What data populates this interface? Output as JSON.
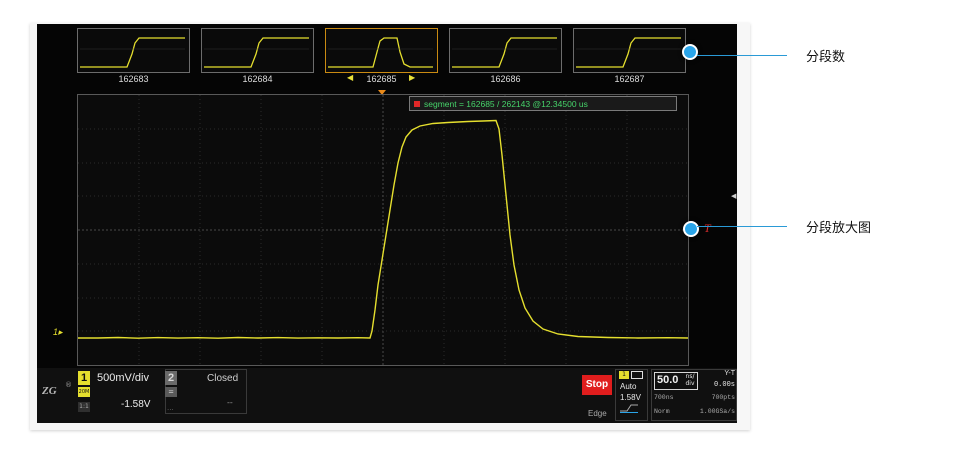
{
  "thumbnails": [
    {
      "label": "162683",
      "selected": false
    },
    {
      "label": "162684",
      "selected": false
    },
    {
      "label": "162685",
      "selected": true
    },
    {
      "label": "162686",
      "selected": false
    },
    {
      "label": "162687",
      "selected": false
    }
  ],
  "thumb_nav": {
    "prev": "◀",
    "next": "▶"
  },
  "segment_info": "segment = 162685 / 262143  @12.34500 us",
  "channel_marker": "1",
  "trigger_label": "T",
  "side_tab": "◀",
  "bottom_bar": {
    "logo": "ZG",
    "logo_reg": "®",
    "ch1": {
      "number": "1",
      "sub": "20M",
      "coupling": "1:1",
      "vdiv": "500mV/div",
      "offset": "-1.58V"
    },
    "ch2": {
      "number": "2",
      "sub": "=",
      "state": "Closed",
      "offset": "--",
      "dots": "..."
    },
    "stop": "Stop",
    "trigger": {
      "channel": "1",
      "mode": "Auto",
      "level": "1.58V",
      "type": "Edge"
    },
    "timebase": {
      "value": "50.0",
      "unit_top": "ns/",
      "unit_bottom": "div",
      "mode": "Y-T",
      "delay": "0.00s"
    },
    "acquisition": {
      "length": "700ns",
      "points": "700pts",
      "mode": "Norm",
      "rate": "1.00GSa/s"
    }
  },
  "callouts": [
    {
      "text": "分段数"
    },
    {
      "text": "分段放大图"
    }
  ],
  "colors": {
    "trace": "#e5df2e",
    "accent": "#2aa4e8",
    "stop": "#e01d1d",
    "segment_text": "#46d46a"
  }
}
